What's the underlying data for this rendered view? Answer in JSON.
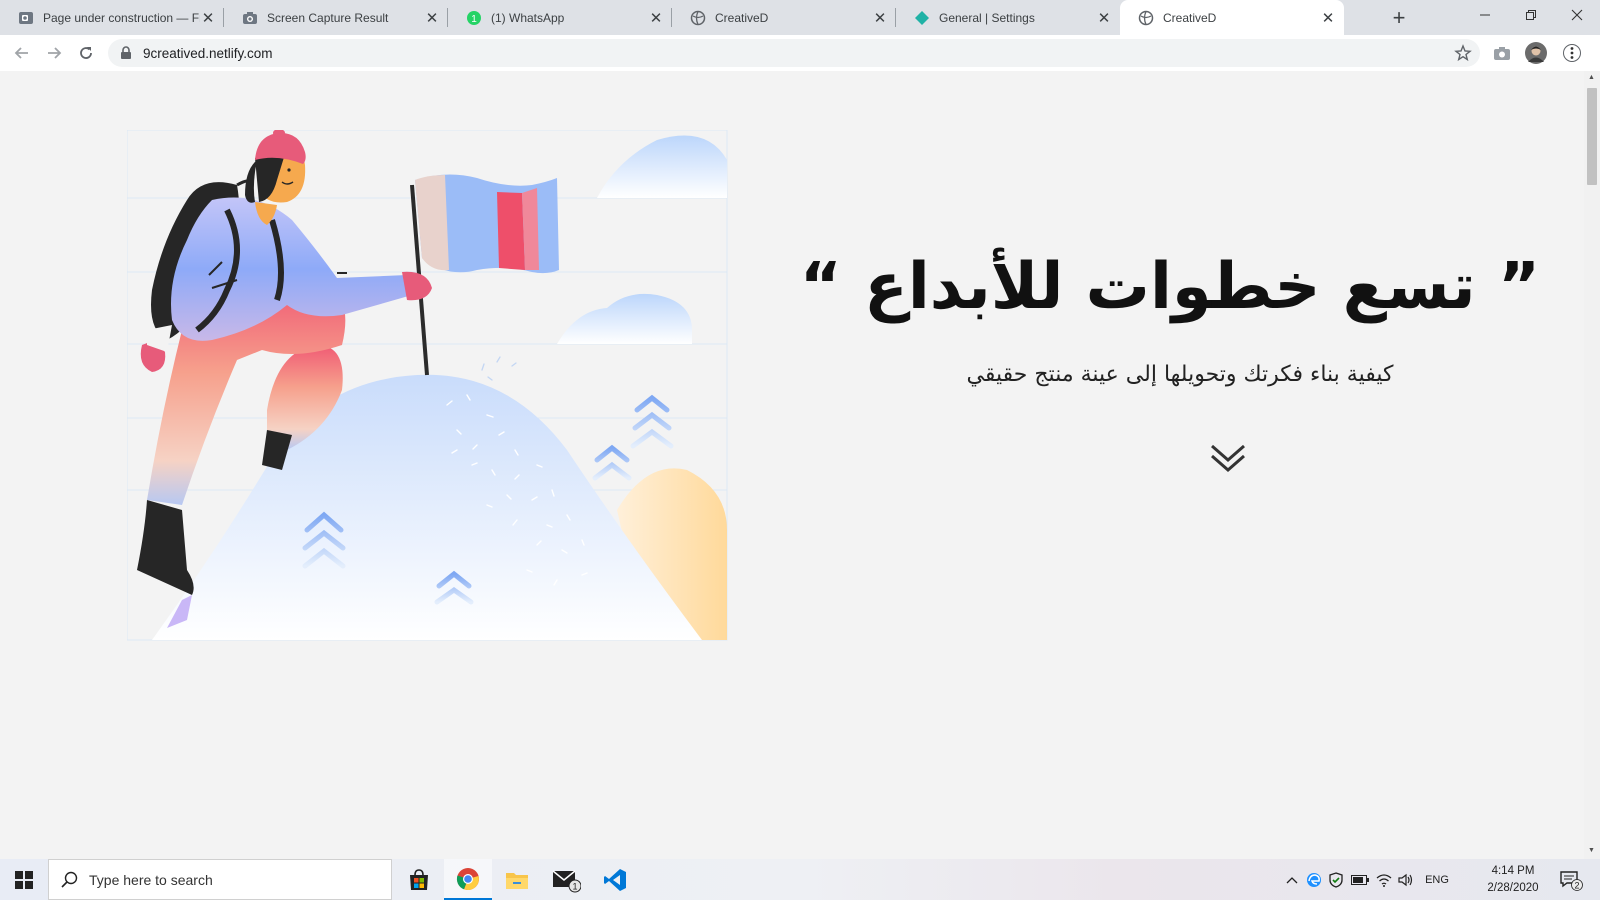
{
  "browser": {
    "tabs": [
      {
        "title": "Page under construction — Fre",
        "icon": "outlook-icon"
      },
      {
        "title": "Screen Capture Result",
        "icon": "camera-icon"
      },
      {
        "title": "(1) WhatsApp",
        "icon": "whatsapp-icon"
      },
      {
        "title": "CreativeD",
        "icon": "globe-icon"
      },
      {
        "title": "General | Settings",
        "icon": "netlify-icon"
      },
      {
        "title": "CreativeD",
        "icon": "globe-icon",
        "active": true
      }
    ],
    "new_tab_label": "+",
    "url": "9creatived.netlify.com"
  },
  "page": {
    "headline": "” تسع خطوات للأبداع “",
    "subheadline": "كيفية بناء فكرتك وتحويلها إلى عينة منتج حقيقي",
    "scroll_icon": "double-chevron-down-icon"
  },
  "taskbar": {
    "search_placeholder": "Type here to search",
    "language": "ENG",
    "time": "4:14 PM",
    "date": "2/28/2020",
    "notification_count": "2",
    "mail_badge": "1"
  }
}
